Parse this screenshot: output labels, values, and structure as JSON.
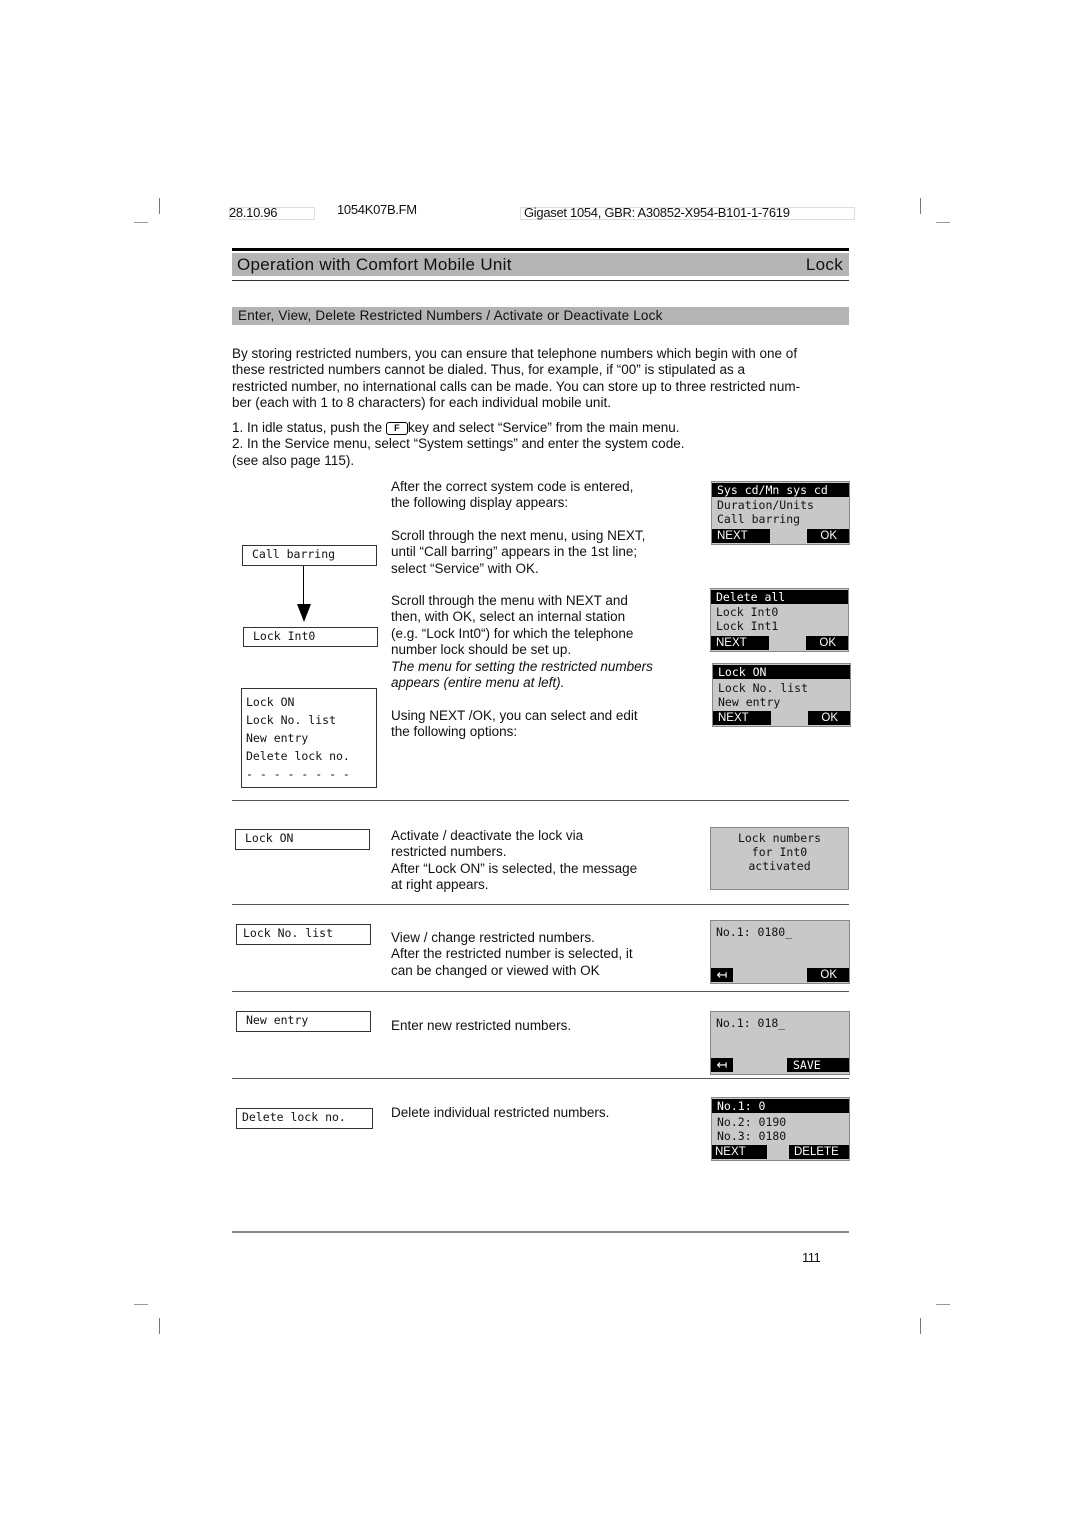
{
  "header": {
    "date": "28.10.96",
    "file": "1054K07B.FM",
    "doc_ref": "Gigaset 1054, GBR: A30852-X954-B101-1-7619"
  },
  "title": {
    "left": "Operation with Comfort Mobile Unit",
    "right": "Lock"
  },
  "section": {
    "heading": "Enter, View, Delete Restricted Numbers / Activate or Deactivate Lock"
  },
  "intro": {
    "lines": [
      "By storing restricted numbers, you can ensure that telephone numbers which begin with one of",
      "these restricted numbers cannot be dialed. Thus, for example, if “00” is stipulated as a",
      "restricted number, no international calls can be made. You can store up to three restricted num-",
      "ber (each with 1 to 8 characters) for each individual mobile unit."
    ]
  },
  "steps": {
    "step1_pre": "1. In idle status, push the",
    "key_label": "F",
    "step1_post": "key and select “Service” from the main menu.",
    "step2": "2. In the Service menu, select “System settings” and enter the system code.",
    "step3": "(see also page 115)."
  },
  "flow": {
    "box1": "Call barring",
    "box2": "Lock Int0",
    "menu_full": [
      "Lock ON",
      "Lock No. list",
      "New entry",
      "Delete lock no.",
      "- - - - - - - -"
    ],
    "desc1": [
      "After the correct system code is entered,",
      "the following display appears:"
    ],
    "desc2": [
      "Scroll through the next menu, using NEXT,",
      "until “Call barring” appears in the 1st line;",
      "select “Service” with OK."
    ],
    "desc3": [
      "Scroll through the menu with NEXT and",
      "then, with OK, select an internal station",
      "(e.g. “Lock Int0“) for which the telephone",
      "number lock should be set up."
    ],
    "desc3_italic": [
      "The menu for setting the restricted numbers",
      "appears (entire menu at left)."
    ],
    "desc4": [
      "Using NEXT /OK, you can select and edit",
      "the following options:"
    ]
  },
  "displays": {
    "d1": {
      "rows": [
        "Sys cd/Mn sys cd",
        "Duration/Units",
        "Call barring"
      ],
      "left": "NEXT",
      "right": "OK"
    },
    "d2": {
      "rows": [
        "Delete all",
        "Lock Int0",
        "Lock Int1"
      ],
      "left": "NEXT",
      "right": "OK"
    },
    "d3": {
      "rows": [
        "Lock ON",
        "Lock No. list",
        "New entry"
      ],
      "left": "NEXT",
      "right": "OK"
    }
  },
  "options": [
    {
      "label": "Lock ON",
      "desc": [
        "Activate / deactivate the lock via",
        "restricted numbers.",
        "After “Lock ON” is selected, the message",
        "at right appears."
      ],
      "display": {
        "rows": [
          "Lock numbers",
          "for Int0",
          "activated"
        ]
      }
    },
    {
      "label": "Lock No. list",
      "desc": [
        "View / change restricted numbers.",
        "After the restricted number is selected, it",
        "can be changed or viewed with OK"
      ],
      "display": {
        "rows": [
          "No.1: 0180_"
        ],
        "left": "↤",
        "right": "OK"
      }
    },
    {
      "label": "New entry",
      "desc": [
        "Enter new restricted numbers."
      ],
      "display": {
        "rows": [
          "No.1: 018_"
        ],
        "left": "↤",
        "right": "SAVE"
      }
    },
    {
      "label": "Delete lock no.",
      "desc": [
        "Delete individual restricted numbers."
      ],
      "display": {
        "rows": [
          "No.1: 0",
          "No.2: 0190",
          "No.3: 0180"
        ],
        "left": "NEXT",
        "right": "DELETE"
      }
    }
  ],
  "footer": {
    "page_number": "111"
  }
}
